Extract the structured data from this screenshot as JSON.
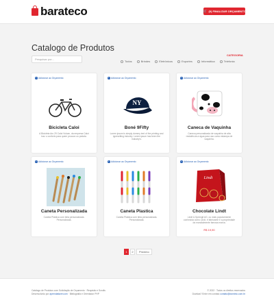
{
  "header": {
    "brand": "barateco",
    "budget_button": "(0) FINALIZAR ORÇAMENTO"
  },
  "main": {
    "title": "Catalogo de Produtos",
    "search_placeholder": "Pesquisar por...",
    "category_label": "CATEGORIA",
    "filters": [
      "Todos",
      "Brindes",
      "Eletrônicos",
      "Esportes",
      "Informática",
      "Telefonia"
    ]
  },
  "products": [
    {
      "add_label": "Adicionar ao Orçamento",
      "name": "Bicicleta Caloi",
      "desc": "A Bicicleta Aro 29 Caloi Vulcan, da empresa Caloi traz o conforto para quem procura ou pedala.",
      "price": "",
      "icon": "bicycle-image"
    },
    {
      "add_label": "Adicionar ao Orçamento",
      "name": "Boné 9Fifty",
      "desc": "Lorem ipsum is simply dummy text of the printing and typesetting industry. Lorem ipsum has been the industry's.",
      "price": "",
      "icon": "cap-image"
    },
    {
      "add_label": "Adicionar ao Orçamento",
      "name": "Caneca de Vaquinha",
      "desc": "Caneca personalizada de vaquinha de alta resistência a água para uso como estampa de vaquinha.",
      "price": "",
      "icon": "mug-image"
    },
    {
      "add_label": "Adicionar ao Orçamento",
      "name": "Caneta Personalizada",
      "desc": "Caneta Plástica com tinta personalizada. Personalizada.",
      "price": "",
      "icon": "pencils-image"
    },
    {
      "add_label": "Adicionar ao Orçamento",
      "name": "Caneta Plastica",
      "desc": "Caneta Plástica com tinta personalizada. Personalizada.",
      "price": "",
      "icon": "pens-image"
    },
    {
      "add_label": "Adicionar ao Orçamento",
      "name": "Chocolate Lindt",
      "desc": "Lindt & Sprüngli AG, ou mais popularmente conhecida como Lindt, é fabricante e a propriedade da mundialmente famosa marca.",
      "price": "R$ 19,90",
      "icon": "chocolate-box-image"
    }
  ],
  "pagination": {
    "pages": [
      "1",
      "2"
    ],
    "next": "Próximo",
    "active": "1"
  },
  "footer": {
    "left_line1": "Catálogo de Produtos com Solicitação de Orçamento · Requisito e Scrolls",
    "left_line2_prefix": "Desenvolvido por ",
    "left_line2_link": "aprendafazer.com",
    "left_line2_suffix": " · Bibliografia e Orientador PHP",
    "right_line1": "© 2022 · Todos os direitos reservados",
    "right_line2_prefix": "Dúvidas? Entre em contato ",
    "right_line2_link": "contato@dominio.com.br"
  },
  "colors": {
    "accent": "#e0262f",
    "link": "#2a63b6"
  }
}
